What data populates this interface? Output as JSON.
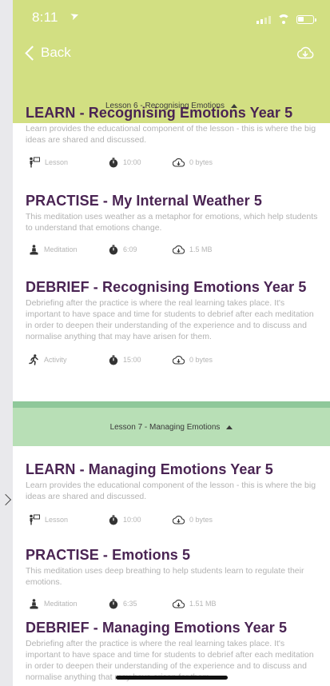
{
  "status_bar": {
    "time": "8:11"
  },
  "nav": {
    "back_label": "Back"
  },
  "lessons": [
    {
      "header": "Lesson 6 - Recognising Emotions",
      "activities": [
        {
          "title": "LEARN - Recognising Emotions Year 5",
          "description": "Learn provides the educational component of the lesson - this is where the big ideas are shared and discussed.",
          "type": "Lesson",
          "duration": "10:00",
          "size": "0 bytes"
        },
        {
          "title": "PRACTISE - My Internal Weather 5",
          "description": "This meditation uses weather as a metaphor for emotions, which help students to understand that emotions change.",
          "type": "Meditation",
          "duration": "6:09",
          "size": "1.5 MB"
        },
        {
          "title": "DEBRIEF - Recognising Emotions Year 5",
          "description": "Debriefing after the practice is where the real learning takes place. It's important to have space and time for students to debrief after each meditation in order to deepen their understanding of the experience and to discuss and normalise anything that may have arisen for them.",
          "type": "Activity",
          "duration": "15:00",
          "size": "0 bytes"
        }
      ]
    },
    {
      "header": "Lesson 7 - Managing Emotions",
      "activities": [
        {
          "title": "LEARN - Managing Emotions Year 5",
          "description": "Learn provides the educational component of the lesson - this is where the big ideas are shared and discussed.",
          "type": "Lesson",
          "duration": "10:00",
          "size": "0 bytes"
        },
        {
          "title": "PRACTISE - Emotions 5",
          "description": "This meditation uses deep breathing to help students learn to regulate their emotions.",
          "type": "Meditation",
          "duration": "6:35",
          "size": "1.51 MB"
        },
        {
          "title": "DEBRIEF - Managing Emotions Year 5",
          "description": "Debriefing after the practice is where the real learning takes place. It's important to have space and time for students to debrief after each meditation in order to deepen their understanding of the experience and to discuss and normalise anything that may have arisen for them."
        }
      ]
    }
  ],
  "colors": {
    "header_green": "#d2df82",
    "lesson7_green": "#b8dfb6",
    "title_purple": "#4a2453",
    "meta_grey": "#b5b5b5"
  },
  "icons": {
    "lesson": "teacher-board-icon",
    "meditation": "meditation-icon",
    "activity": "running-person-icon",
    "duration": "stopwatch-icon",
    "size": "cloud-download-icon",
    "download_all": "cloud-download-icon",
    "back": "chevron-left-icon"
  }
}
